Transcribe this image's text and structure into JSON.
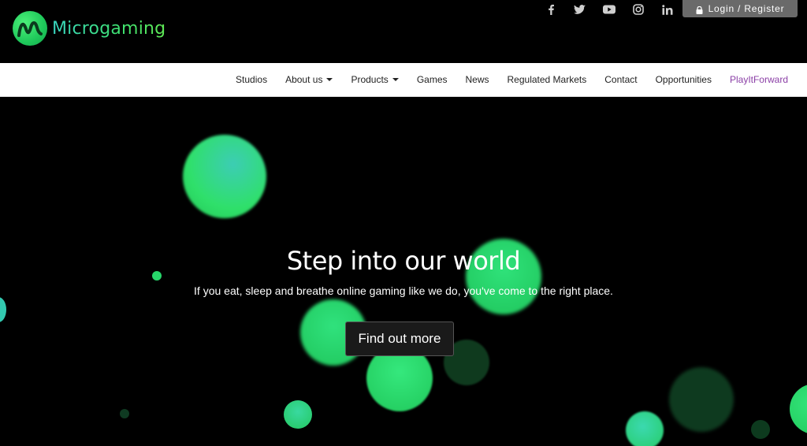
{
  "brand": {
    "name": "Microgaming",
    "logo_icon": "microgaming-logo-icon"
  },
  "socials": [
    {
      "name": "facebook-icon",
      "glyph": "f"
    },
    {
      "name": "twitter-icon",
      "glyph": "t"
    },
    {
      "name": "youtube-icon",
      "glyph": "▶"
    },
    {
      "name": "instagram-icon",
      "glyph": "◎"
    },
    {
      "name": "linkedin-icon",
      "glyph": "in"
    }
  ],
  "login": {
    "label": "Login / Register",
    "icon": "lock-icon"
  },
  "nav": {
    "items": [
      {
        "label": "Studios",
        "dropdown": false
      },
      {
        "label": "About us",
        "dropdown": true
      },
      {
        "label": "Products",
        "dropdown": true
      },
      {
        "label": "Games",
        "dropdown": false
      },
      {
        "label": "News",
        "dropdown": false
      },
      {
        "label": "Regulated Markets",
        "dropdown": false
      },
      {
        "label": "Contact",
        "dropdown": false
      },
      {
        "label": "Opportunities",
        "dropdown": false
      },
      {
        "label": "PlayItForward",
        "dropdown": false,
        "accent": "#8b3fa6"
      }
    ]
  },
  "hero": {
    "title": "Step into our world",
    "subtitle": "If you eat, sleep and breathe online gaming like we do, you've come to the right place.",
    "cta_label": "Find out more"
  },
  "colors": {
    "brand_green": "#2fdc5e",
    "accent_purple": "#8b3fa6",
    "background": "#000000"
  }
}
